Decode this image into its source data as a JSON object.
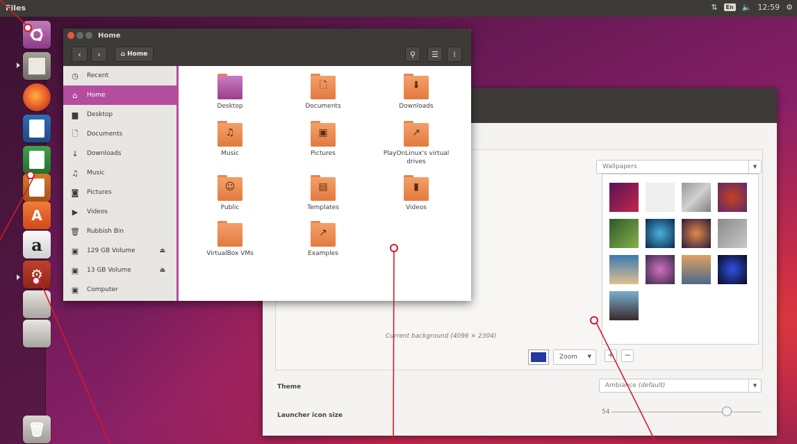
{
  "top_panel": {
    "app_name": "Files",
    "keyboard_layout": "En",
    "clock": "12:59"
  },
  "launcher": {
    "items": [
      {
        "name": "ubuntu-dash-icon"
      },
      {
        "name": "files-icon"
      },
      {
        "name": "firefox-icon"
      },
      {
        "name": "libreoffice-writer-icon"
      },
      {
        "name": "libreoffice-calc-icon"
      },
      {
        "name": "libreoffice-impress-icon"
      },
      {
        "name": "software-center-icon",
        "glyph": "A"
      },
      {
        "name": "amazon-icon",
        "glyph": "a"
      },
      {
        "name": "system-settings-icon"
      },
      {
        "name": "drive-icon"
      },
      {
        "name": "drive-icon"
      },
      {
        "name": "trash-icon"
      }
    ]
  },
  "files_window": {
    "title": "Home",
    "location": "Home",
    "sidebar": [
      {
        "icon": "clock-icon",
        "glyph": "◷",
        "label": "Recent",
        "active": false
      },
      {
        "icon": "home-icon",
        "glyph": "⌂",
        "label": "Home",
        "active": true
      },
      {
        "icon": "desktop-folder-icon",
        "glyph": "▆",
        "label": "Desktop",
        "active": false
      },
      {
        "icon": "document-icon",
        "glyph": "🗋",
        "label": "Documents",
        "active": false
      },
      {
        "icon": "download-icon",
        "glyph": "↓",
        "label": "Downloads",
        "active": false
      },
      {
        "icon": "music-icon",
        "glyph": "♫",
        "label": "Music",
        "active": false
      },
      {
        "icon": "camera-icon",
        "glyph": "◙",
        "label": "Pictures",
        "active": false
      },
      {
        "icon": "video-icon",
        "glyph": "▶",
        "label": "Videos",
        "active": false
      },
      {
        "icon": "trash-icon",
        "glyph": "🗑",
        "label": "Rubbish Bin",
        "active": false
      },
      {
        "icon": "drive-icon",
        "glyph": "▣",
        "label": "129 GB Volume",
        "eject": "⏏",
        "active": false
      },
      {
        "icon": "drive-icon",
        "glyph": "▣",
        "label": "13 GB Volume",
        "eject": "⏏",
        "active": false
      },
      {
        "icon": "computer-icon",
        "glyph": "▣",
        "label": "Computer",
        "active": false
      }
    ],
    "folders": [
      {
        "label": "Desktop",
        "glyph": "",
        "style": "purple"
      },
      {
        "label": "Documents",
        "glyph": "🗋",
        "style": "orange"
      },
      {
        "label": "Downloads",
        "glyph": "⬇",
        "style": "orange"
      },
      {
        "label": "Music",
        "glyph": "♫",
        "style": "orange"
      },
      {
        "label": "Pictures",
        "glyph": "▣",
        "style": "orange"
      },
      {
        "label": "PlayOnLinux's virtual drives",
        "glyph": "↗",
        "style": "orange"
      },
      {
        "label": "Public",
        "glyph": "☺",
        "style": "orange"
      },
      {
        "label": "Templates",
        "glyph": "▤",
        "style": "orange"
      },
      {
        "label": "Videos",
        "glyph": "▮",
        "style": "orange"
      },
      {
        "label": "VirtualBox VMs",
        "glyph": "",
        "style": "orange"
      },
      {
        "label": "Examples",
        "glyph": "↗",
        "style": "orange"
      }
    ]
  },
  "appearance": {
    "wallpaper_source": "Wallpapers",
    "current_background": "Current background (4096 × 2304)",
    "zoom": "Zoom",
    "color": "#2338a0",
    "theme_label": "Theme",
    "theme_value": "Ambiance",
    "theme_suffix": "(default)",
    "launcher_size_label": "Launcher icon size",
    "launcher_size_value": "54",
    "launcher_size_fraction": 0.77,
    "add": "+",
    "remove": "−"
  },
  "colors": {
    "accent": "#b44d9e",
    "annotation": "#d21a2a",
    "panel": "#3c3b37"
  }
}
